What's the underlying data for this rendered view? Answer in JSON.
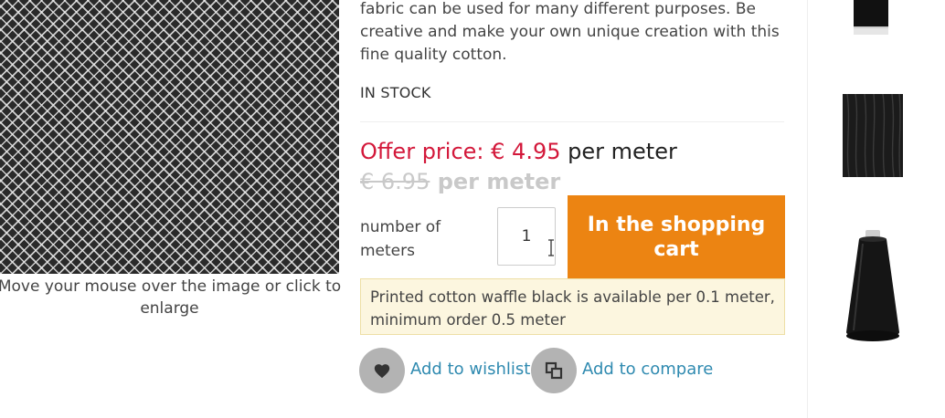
{
  "product": {
    "description": "fabric can be used for many different purposes. Be creative and make your own unique creation with this fine quality cotton.",
    "stock_status": "IN STOCK",
    "image_caption": "Move your mouse over the image or click to enlarge"
  },
  "pricing": {
    "offer_label": "Offer price:",
    "offer_price": "€ 4.95",
    "offer_unit": "per meter",
    "old_price": "€ 6.95",
    "old_unit": "per meter"
  },
  "order": {
    "quantity_label": "number of meters",
    "quantity_value": "1",
    "cart_button_label": "In the shopping cart",
    "availability_note": "Printed cotton waffle black is available per 0.1 meter, minimum order 0.5 meter"
  },
  "actions": {
    "wishlist_label": "Add to wishlist",
    "compare_label": "Add to compare"
  },
  "colors": {
    "offer_red": "#d3183a",
    "cart_orange": "#ec8412",
    "link_blue": "#2f8ab0",
    "notice_bg": "#fcf6df"
  },
  "icons": [
    "heart-icon",
    "compare-icon",
    "text-cursor-icon"
  ]
}
